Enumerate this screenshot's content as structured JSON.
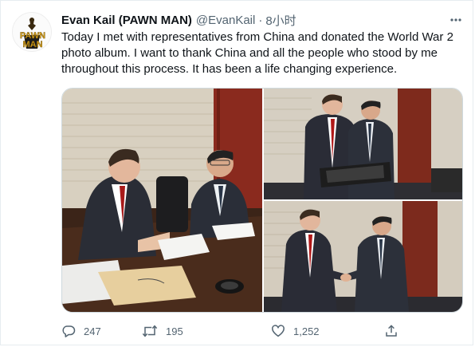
{
  "tweet": {
    "display_name": "Evan Kail (PAWN MAN)",
    "handle": "@EvanKail",
    "separator": "·",
    "time": "8小时",
    "text": "Today I met with representatives from China and donated the World War 2 photo album. I want to thank China and all the people who stood by me throughout this process. It has been a life changing experience.",
    "avatar_logo": "PAWN MAN",
    "media_alt": [
      "Two men signing documents at a table",
      "Two men holding the photo album",
      "Two men shaking hands"
    ]
  },
  "actions": {
    "reply_count": "247",
    "retweet_count": "195",
    "like_count": "1,252",
    "icons": [
      "reply-icon",
      "retweet-icon",
      "like-icon",
      "share-icon"
    ]
  },
  "colors": {
    "text_primary": "#0f1419",
    "text_secondary": "#536471",
    "border": "#cfd9de",
    "logo_gold": "#d9a521"
  }
}
